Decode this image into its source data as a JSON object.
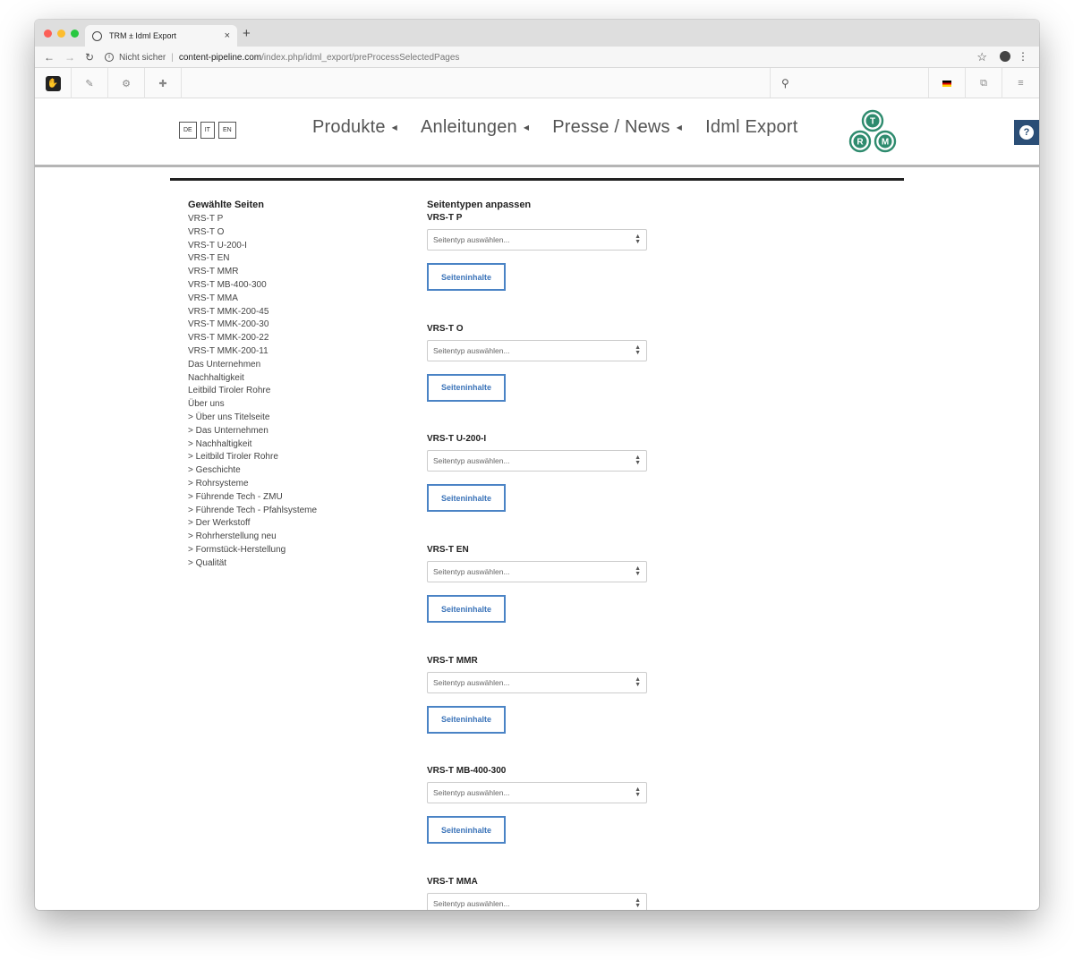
{
  "browser": {
    "tab_title": "TRM ± Idml Export",
    "tab_close": "×",
    "new_tab": "+",
    "not_secure": "Nicht sicher",
    "url_host": "content-pipeline.com",
    "url_path": "/index.php/idml_export/preProcessSelectedPages"
  },
  "header": {
    "languages": [
      "DE",
      "IT",
      "EN"
    ],
    "nav": [
      {
        "label": "Produkte",
        "caret": true
      },
      {
        "label": "Anleitungen",
        "caret": true
      },
      {
        "label": "Presse / News",
        "caret": true
      },
      {
        "label": "Idml Export",
        "caret": false
      }
    ],
    "logo_letters": [
      "T",
      "R",
      "M"
    ],
    "logo_color": "#2e8b6e",
    "help_label": "?"
  },
  "selected_pages": {
    "heading": "Gewählte Seiten",
    "items": [
      "VRS-T P",
      "VRS-T O",
      "VRS-T U-200-I",
      "VRS-T EN",
      "VRS-T MMR",
      "VRS-T MB-400-300",
      "VRS-T MMA",
      "VRS-T MMK-200-45",
      "VRS-T MMK-200-30",
      "VRS-T MMK-200-22",
      "VRS-T MMK-200-11",
      "Das Unternehmen",
      "Nachhaltigkeit",
      "Leitbild Tiroler Rohre",
      "Über uns",
      "> Über uns Titelseite",
      "> Das Unternehmen",
      "> Nachhaltigkeit",
      "> Leitbild Tiroler Rohre",
      "> Geschichte",
      "> Rohrsysteme",
      "> Führende Tech - ZMU",
      "> Führende Tech - Pfahlsysteme",
      "> Der Werkstoff",
      "> Rohrherstellung neu",
      "> Formstück-Herstellung",
      "> Qualität"
    ]
  },
  "page_types": {
    "heading": "Seitentypen anpassen",
    "select_placeholder": "Seitentyp auswählen...",
    "button_label": "Seiteninhalte",
    "sections": [
      "VRS-T P",
      "VRS-T O",
      "VRS-T U-200-I",
      "VRS-T EN",
      "VRS-T MMR",
      "VRS-T MB-400-300",
      "VRS-T MMA"
    ]
  },
  "colors": {
    "accent": "#4a83c5",
    "help_bg": "#2b4e76"
  }
}
